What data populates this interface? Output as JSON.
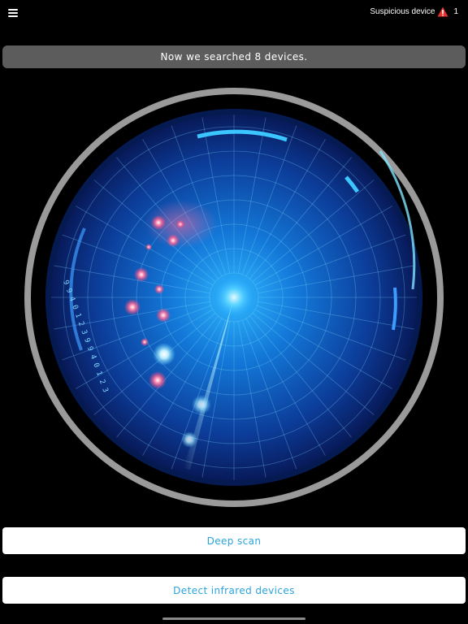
{
  "header": {
    "menu_icon": "hamburger-menu-icon",
    "suspicious_label": "Suspicious device",
    "suspicious_icon": "warning-icon",
    "suspicious_count": "1"
  },
  "status": {
    "message": "Now we searched 8 devices."
  },
  "radar": {
    "scale_text": "9 9 4 0 1 2 3 9 9 4 0 1 2 3",
    "colors": {
      "ring": "#9a9a9a",
      "radar_core": "#1e9cff",
      "radar_edge": "#0a1b5c",
      "device_dot": "#ff4f86"
    }
  },
  "buttons": {
    "deep_scan": "Deep scan",
    "detect_infrared": "Detect infrared devices"
  },
  "colors": {
    "background": "#000000",
    "status_bar": "#5c5c5c",
    "button_text": "#2aa3dc",
    "warning": "#e5322d"
  }
}
